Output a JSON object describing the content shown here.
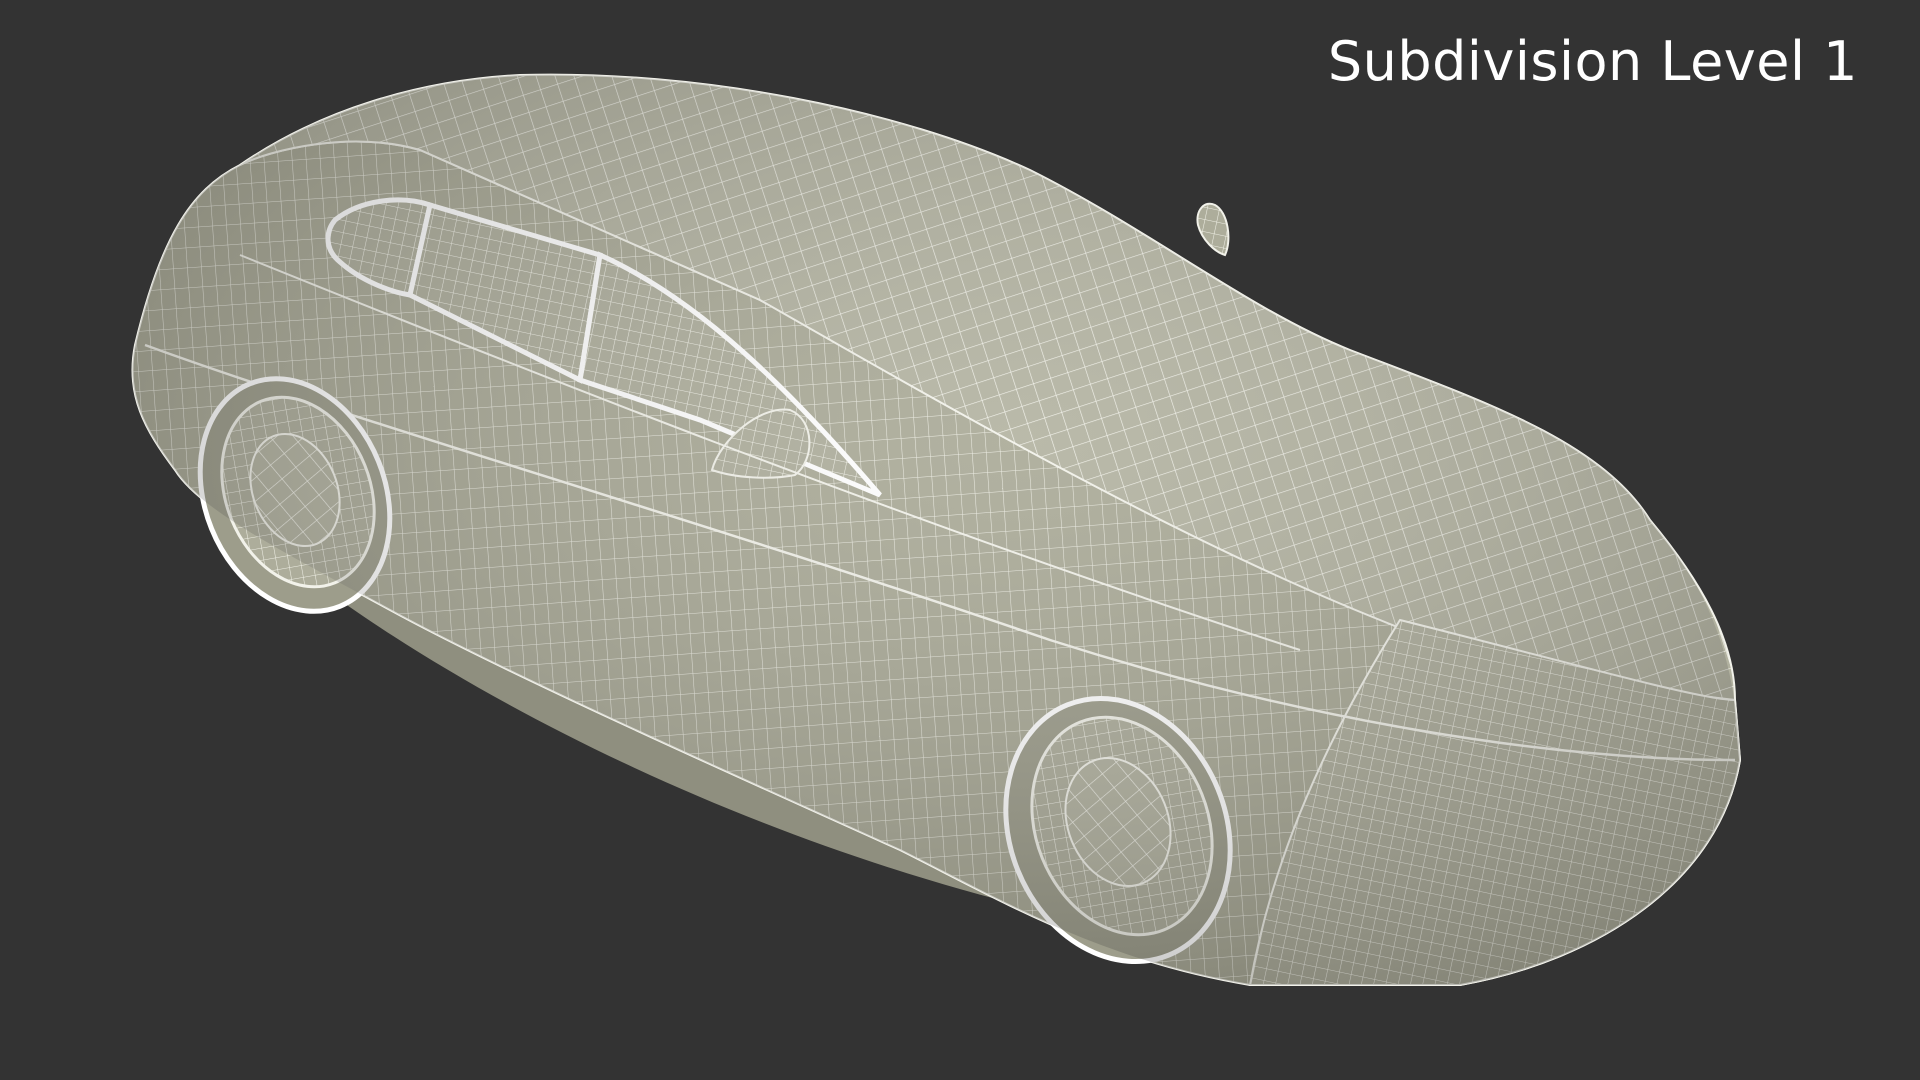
{
  "viewport": {
    "background_color": "#333333"
  },
  "render_label": {
    "text": "Subdivision Level 1",
    "color": "#ffffff"
  },
  "model": {
    "subject": "sedan car wireframe",
    "shading": "clay with white wireframe overlay",
    "surface_color": "#b2b2a0",
    "wire_color": "#f2f2ea"
  }
}
